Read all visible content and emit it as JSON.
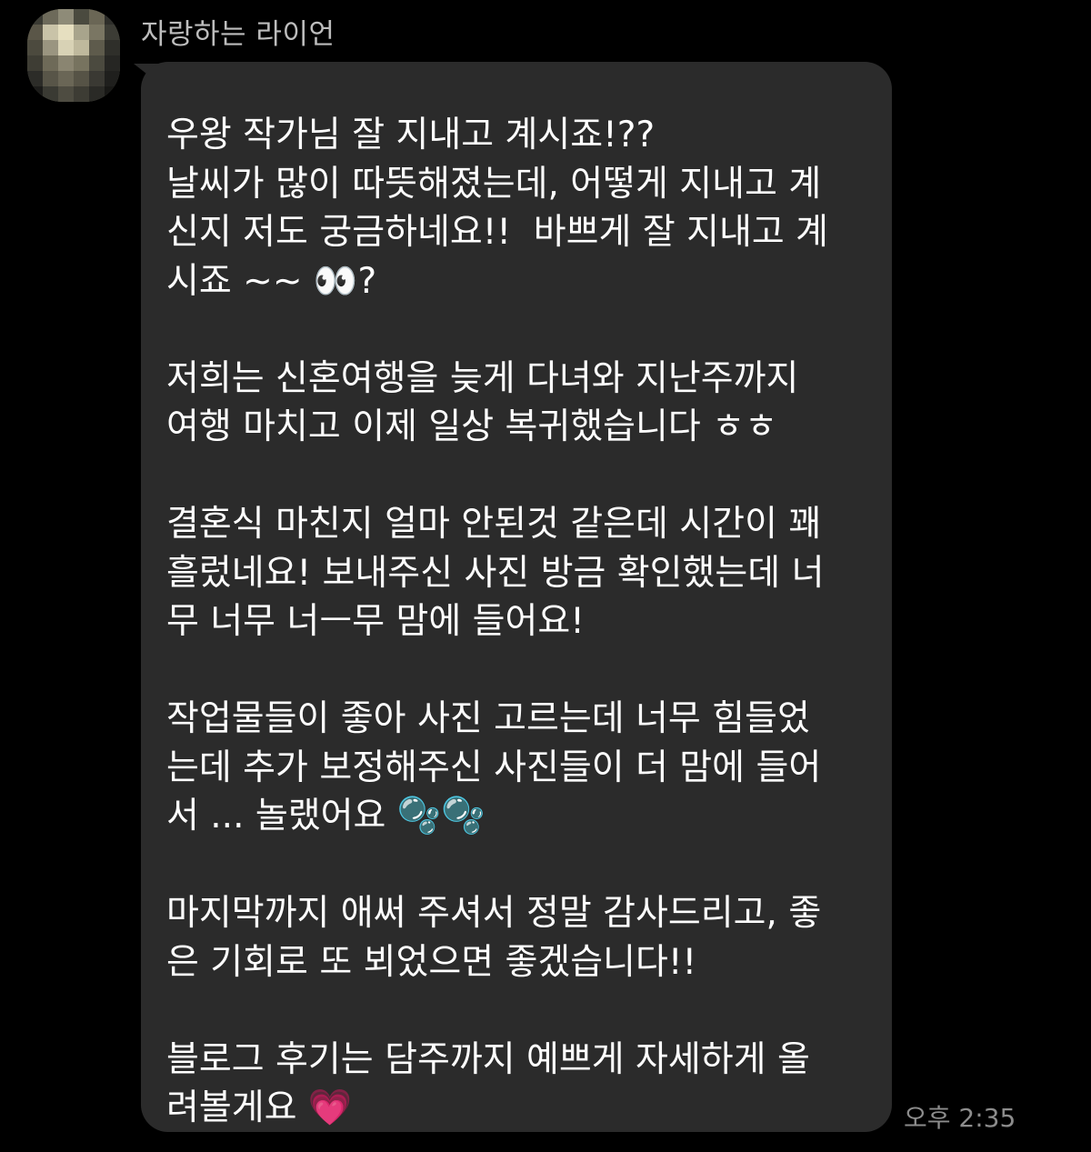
{
  "sender": {
    "name": "자랑하는 라이언",
    "avatar_pixels": [
      "#3a3a33",
      "#6d6a5a",
      "#8e8b78",
      "#4a4a3f",
      "#6a6655",
      "#2e2e2a",
      "#5a5648",
      "#c9c3a8",
      "#e6dfc0",
      "#a8a48c",
      "#7a7663",
      "#3c3c35",
      "#4c4a3e",
      "#9a9580",
      "#d8d2b5",
      "#bfb99d",
      "#5e5b4c",
      "#2f2f2a",
      "#3e3d34",
      "#6e6a58",
      "#8a8571",
      "#77735f",
      "#4b4a3f",
      "#262623",
      "#2c2c28",
      "#585548",
      "#6a6656",
      "#565346",
      "#3a3933",
      "#1f1f1d",
      "#1c1c1a",
      "#3a3a33",
      "#4e4c41",
      "#3d3c34",
      "#2a2a26",
      "#181816"
    ]
  },
  "message": {
    "lines": [
      "우왕 작가님 잘 지내고 계시죠!??",
      "날씨가 많이 따뜻해졌는데, 어떻게 지내고 계",
      "신지 저도 궁금하네요!!  바쁘게 잘 지내고 계",
      "시죠 ~~ 👀?",
      "",
      "저희는 신혼여행을 늦게 다녀와 지난주까지",
      "여행 마치고 이제 일상 복귀했습니다 ㅎㅎ",
      "",
      "결혼식 마친지 얼마 안된것 같은데 시간이 꽤",
      "흘렀네요! 보내주신 사진 방금 확인했는데 너",
      "무 너무 너ㅡ무 맘에 들어요!",
      "",
      "작업물들이 좋아 사진 고르는데 너무 힘들었",
      "는데 추가 보정해주신 사진들이 더 맘에 들어",
      "서 ... 놀랬어요 🫧🫧",
      "",
      "마지막까지 애써 주셔서 정말 감사드리고, 좋",
      "은 기회로 또 뵈었으면 좋겠습니다!!",
      "",
      "블로그 후기는 담주까지 예쁘게 자세하게 올",
      "려볼게요 💗"
    ]
  },
  "timestamp": "오후 2:35",
  "colors": {
    "background": "#000000",
    "bubble": "#2b2b2b",
    "text": "#ffffff",
    "name": "#bdbdbd",
    "timestamp": "#8c8c8c"
  }
}
